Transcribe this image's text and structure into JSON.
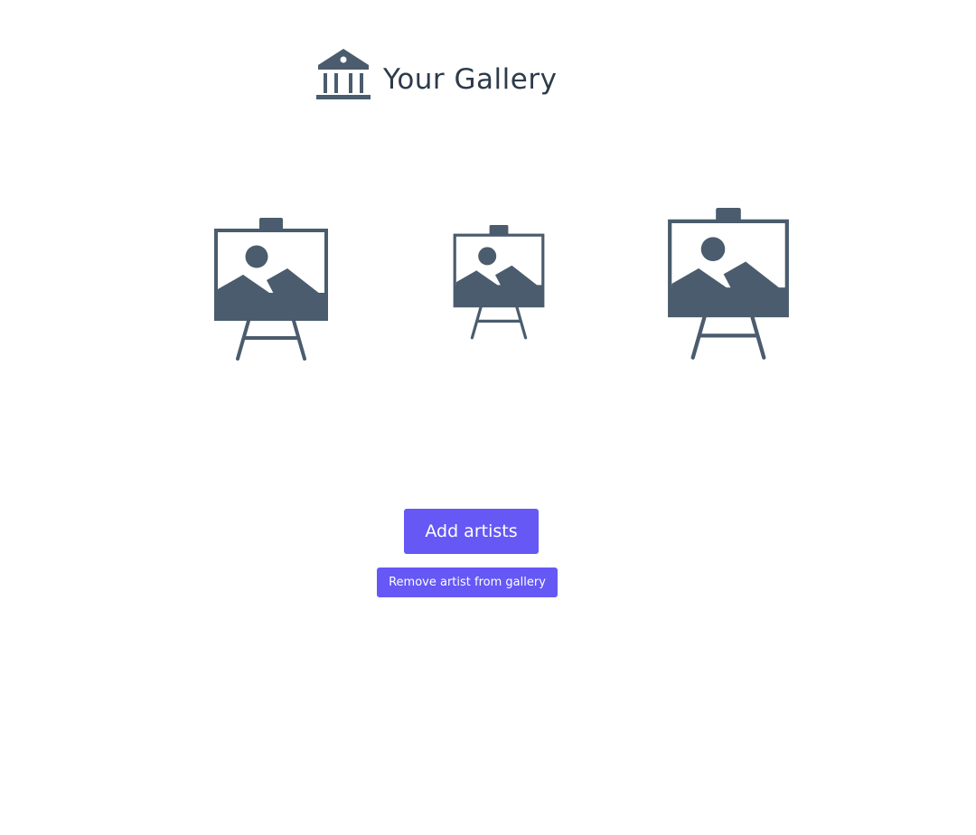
{
  "header": {
    "title": "Your Gallery",
    "icon": "museum-icon"
  },
  "artworks": [
    {
      "icon": "easel-image-icon"
    },
    {
      "icon": "easel-image-icon"
    },
    {
      "icon": "easel-image-icon"
    }
  ],
  "actions": {
    "add_label": "Add artists",
    "remove_label": "Remove artist from gallery"
  },
  "colors": {
    "icon": "#4a5c6d",
    "title": "#2d3b4b",
    "button": "#6558f5",
    "button_text": "#ffffff"
  }
}
